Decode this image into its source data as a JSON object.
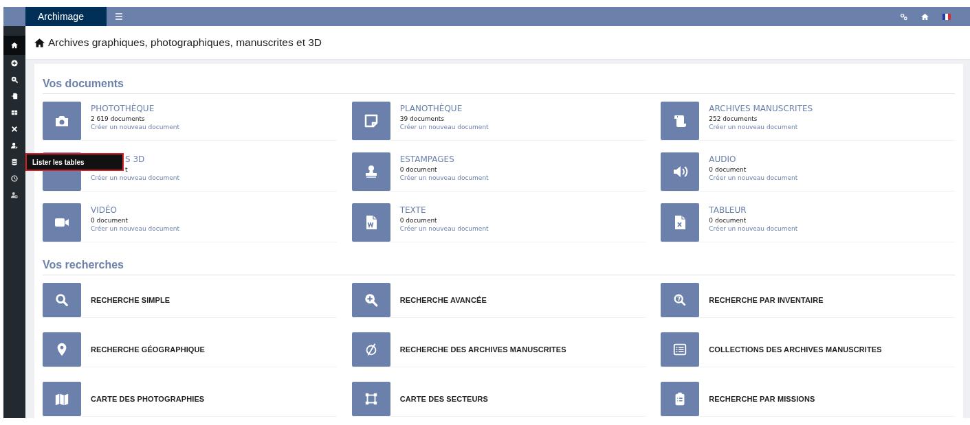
{
  "topbar": {
    "app_name": "Archimage"
  },
  "sidebar": {
    "items": [
      {
        "selected": true
      },
      {
        "selected": false
      },
      {
        "selected": false
      },
      {
        "selected": false
      },
      {
        "selected": false
      },
      {
        "selected": false
      },
      {
        "selected": false
      },
      {
        "selected": false,
        "tooltip": "Lister les tables"
      },
      {
        "selected": false
      },
      {
        "selected": false
      }
    ]
  },
  "breadcrumb": "Archives graphiques, photographiques, manuscrites et 3D",
  "documents": {
    "heading": "Vos documents",
    "items": [
      {
        "title": "PHOTOTHÈQUE",
        "count": "2 619 documents",
        "link": "Créer un nouveau document",
        "covered": false
      },
      {
        "title": "PLANOTHÈQUE",
        "count": "39 documents",
        "link": "Créer un nouveau document",
        "covered": false
      },
      {
        "title": "ARCHIVES MANUSCRITES",
        "count": "252 documents",
        "link": "Créer un nouveau document",
        "covered": false
      },
      {
        "title": "S 3D",
        "count": "t",
        "link": "Créer un nouveau document",
        "covered": true
      },
      {
        "title": "ESTAMPAGES",
        "count": "0 document",
        "link": "Créer un nouveau document",
        "covered": false
      },
      {
        "title": "AUDIO",
        "count": "0 document",
        "link": "Créer un nouveau document",
        "covered": false
      },
      {
        "title": "VIDÉO",
        "count": "0 document",
        "link": "Créer un nouveau document",
        "covered": false
      },
      {
        "title": "TEXTE",
        "count": "0 document",
        "link": "Créer un nouveau document",
        "covered": false
      },
      {
        "title": "TABLEUR",
        "count": "0 document",
        "link": "Créer un nouveau document",
        "covered": false
      }
    ]
  },
  "searches": {
    "heading": "Vos recherches",
    "items": [
      {
        "label": "RECHERCHE SIMPLE"
      },
      {
        "label": "RECHERCHE AVANCÉE"
      },
      {
        "label": "RECHERCHE PAR INVENTAIRE"
      },
      {
        "label": "RECHERCHE GÉOGRAPHIQUE"
      },
      {
        "label": "RECHERCHE DES ARCHIVES MANUSCRITES"
      },
      {
        "label": "COLLECTIONS DES ARCHIVES MANUSCRITES"
      },
      {
        "label": "CARTE DES PHOTOGRAPHIES"
      },
      {
        "label": "CARTE DES SECTEURS"
      },
      {
        "label": "RECHERCHE PAR MISSIONS"
      }
    ]
  }
}
